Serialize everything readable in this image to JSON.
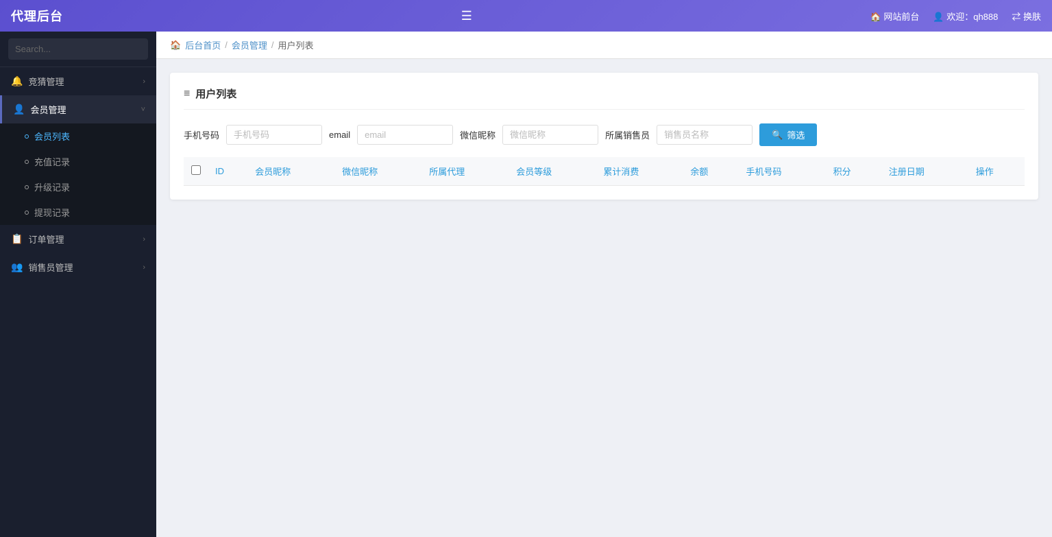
{
  "app": {
    "title": "代理后台"
  },
  "header": {
    "toggle_icon": "☰",
    "site_link": "🏠 网站前台",
    "user_welcome": "👤 欢迎：qh888",
    "switch_label": "⇄ 换肤"
  },
  "sidebar": {
    "search_placeholder": "Search...",
    "search_icon": "🔍",
    "nav_items": [
      {
        "id": "jingsai",
        "label": "竞猜管理",
        "icon": "🔔",
        "has_children": true,
        "expanded": false
      },
      {
        "id": "huiyuan",
        "label": "会员管理",
        "icon": "👤",
        "has_children": true,
        "expanded": true,
        "children": [
          {
            "id": "huiyuan-list",
            "label": "会员列表",
            "active": true
          },
          {
            "id": "chongzhi",
            "label": "充值记录",
            "active": false
          },
          {
            "id": "shengji",
            "label": "升级记录",
            "active": false
          },
          {
            "id": "tixian",
            "label": "提现记录",
            "active": false
          }
        ]
      },
      {
        "id": "dingdan",
        "label": "订单管理",
        "icon": "📋",
        "has_children": true,
        "expanded": false
      },
      {
        "id": "xiaoshou",
        "label": "销售员管理",
        "icon": "👥",
        "has_children": true,
        "expanded": false
      }
    ]
  },
  "breadcrumb": {
    "home": "后台首页",
    "parent": "会员管理",
    "current": "用户列表"
  },
  "page_title": "用户列表",
  "filter": {
    "phone_label": "手机号码",
    "phone_placeholder": "手机号码",
    "email_label": "email",
    "email_placeholder": "email",
    "wechat_label": "微信昵称",
    "wechat_placeholder": "微信昵称",
    "seller_label": "所属销售员",
    "seller_placeholder": "销售员名称",
    "search_btn_icon": "🔍",
    "search_btn_label": "筛选"
  },
  "table": {
    "columns": [
      {
        "id": "checkbox",
        "label": ""
      },
      {
        "id": "id",
        "label": "ID"
      },
      {
        "id": "member_nickname",
        "label": "会员昵称"
      },
      {
        "id": "wechat_nickname",
        "label": "微信昵称"
      },
      {
        "id": "affiliated_agent",
        "label": "所属代理"
      },
      {
        "id": "member_level",
        "label": "会员等级"
      },
      {
        "id": "total_consumption",
        "label": "累计消费"
      },
      {
        "id": "balance",
        "label": "余额"
      },
      {
        "id": "phone",
        "label": "手机号码"
      },
      {
        "id": "points",
        "label": "积分"
      },
      {
        "id": "register_date",
        "label": "注册日期"
      },
      {
        "id": "actions",
        "label": "操作"
      }
    ],
    "rows": []
  }
}
